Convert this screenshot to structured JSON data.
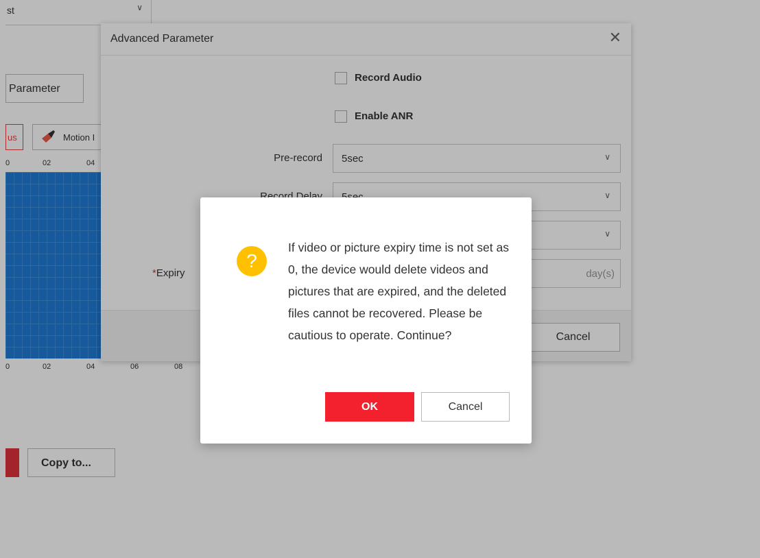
{
  "background": {
    "top_select": {
      "value": "st"
    },
    "parameter_button": "Parameter",
    "mode_buttons": [
      "us",
      "Motion I"
    ],
    "ruler_top": [
      "0",
      "02",
      "04"
    ],
    "ruler_bottom": [
      "0",
      "02",
      "04",
      "06",
      "08"
    ],
    "grid_color": "#1f7bd6",
    "copy_button": "Copy to..."
  },
  "advanced_dialog": {
    "title": "Advanced Parameter",
    "checkboxes": [
      {
        "label": "Record Audio",
        "checked": false
      },
      {
        "label": "Enable ANR",
        "checked": false
      }
    ],
    "pre_record": {
      "label": "Pre-record",
      "value": "5sec"
    },
    "record_delay": {
      "label": "Record Delay",
      "value": "5sec"
    },
    "third_select": {
      "value": ""
    },
    "expiry": {
      "required_mark": "*",
      "label": "Expiry",
      "unit": "day(s)"
    },
    "cancel_label": "Cancel"
  },
  "confirm_dialog": {
    "icon": "question-icon",
    "icon_color": "#ffc000",
    "message": "If video or picture expiry time is not set as 0, the device would delete videos and pictures that are expired, and the deleted files cannot be recovered. Please be cautious to operate. Continue?",
    "ok_label": "OK",
    "cancel_label": "Cancel",
    "ok_color": "#f2212d"
  }
}
